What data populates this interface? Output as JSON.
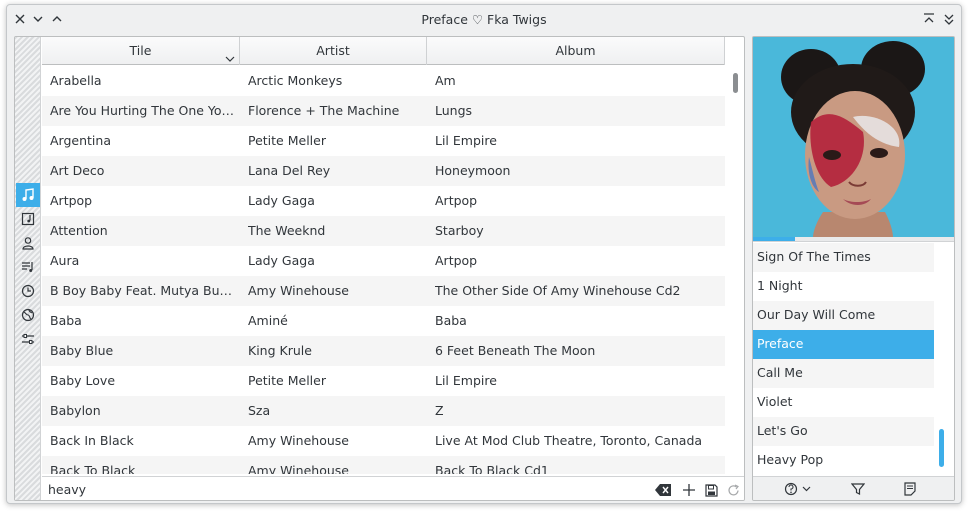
{
  "window": {
    "title": "Preface ♡ Fka Twigs"
  },
  "columns": {
    "title": "Tile",
    "artist": "Artist",
    "album": "Album"
  },
  "tracks": [
    {
      "title": "Arabella",
      "artist": "Arctic Monkeys",
      "album": "Am"
    },
    {
      "title": "Are You Hurting The One You Lo...",
      "artist": "Florence + The Machine",
      "album": "Lungs"
    },
    {
      "title": "Argentina",
      "artist": "Petite Meller",
      "album": "Lil Empire"
    },
    {
      "title": "Art Deco",
      "artist": "Lana Del Rey",
      "album": "Honeymoon"
    },
    {
      "title": "Artpop",
      "artist": "Lady Gaga",
      "album": "Artpop"
    },
    {
      "title": "Attention",
      "artist": "The Weeknd",
      "album": "Starboy"
    },
    {
      "title": "Aura",
      "artist": "Lady Gaga",
      "album": "Artpop"
    },
    {
      "title": "B Boy Baby Feat. Mutya Buena",
      "artist": "Amy Winehouse",
      "album": "The Other Side Of Amy Winehouse Cd2"
    },
    {
      "title": "Baba",
      "artist": "Aminé",
      "album": "Baba"
    },
    {
      "title": "Baby Blue",
      "artist": "King Krule",
      "album": "6 Feet Beneath The Moon"
    },
    {
      "title": "Baby Love",
      "artist": "Petite Meller",
      "album": "Lil Empire"
    },
    {
      "title": "Babylon",
      "artist": "Sza",
      "album": "Z"
    },
    {
      "title": "Back In Black",
      "artist": "Amy Winehouse",
      "album": "Live At Mod Club Theatre, Toronto, Canada"
    },
    {
      "title": "Back To Black",
      "artist": "Amy Winehouse",
      "album": "Back To Black Cd1"
    }
  ],
  "filter": {
    "value": "heavy"
  },
  "playback": {
    "progress_fraction": 0.21
  },
  "playlist": {
    "items": [
      "Sign Of The Times",
      "1 Night",
      "Our Day Will Come",
      "Preface",
      "Call Me",
      "Violet",
      "Let's Go",
      "Heavy Pop"
    ],
    "selected_index": 3
  },
  "colors": {
    "accent": "#3daee9",
    "window_bg": "#eff0f1",
    "text": "#31363b",
    "album_art_bg": "#49b6d9"
  },
  "icons": {
    "sidebar": [
      "music-note-icon",
      "album-icon",
      "artist-icon",
      "playlist-icon",
      "recent-icon",
      "globe-icon",
      "settings-sliders-icon"
    ],
    "filter_bar": [
      "clear-icon",
      "add-icon",
      "save-icon",
      "refresh-icon"
    ],
    "playlist_toolbar": [
      "repeat-mode-icon",
      "filter-icon",
      "notes-icon"
    ]
  }
}
